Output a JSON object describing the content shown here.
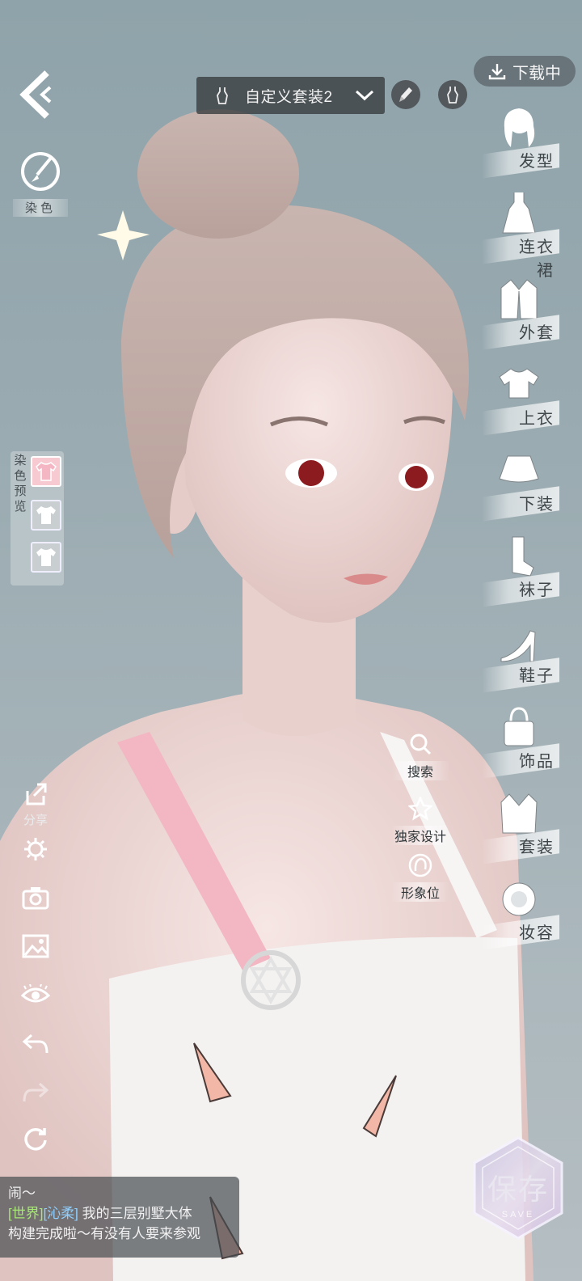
{
  "top_bar": {
    "outfit_name": "自定义套装2",
    "download_label": "下载中"
  },
  "left_panel": {
    "dye_label": "染色",
    "dye_preview_title": [
      "染",
      "色",
      "预",
      "览"
    ],
    "share_label": "分享"
  },
  "categories": [
    {
      "label": "发型",
      "icon": "hair-icon"
    },
    {
      "label": "连衣裙",
      "icon": "dress-icon"
    },
    {
      "label": "外套",
      "icon": "coat-icon"
    },
    {
      "label": "上衣",
      "icon": "top-icon"
    },
    {
      "label": "下装",
      "icon": "skirt-icon"
    },
    {
      "label": "袜子",
      "icon": "socks-icon"
    },
    {
      "label": "鞋子",
      "icon": "heels-icon"
    },
    {
      "label": "饰品",
      "icon": "handbag-icon"
    },
    {
      "label": "套装",
      "icon": "suit-icon"
    },
    {
      "label": "妆容",
      "icon": "makeup-icon"
    }
  ],
  "center_actions": {
    "search": "搜索",
    "exclusive_design": "独家设计",
    "image_slot": "形象位"
  },
  "chat": {
    "line1": "闹～",
    "channel": "[世界]",
    "sender": "[沁柔]",
    "message_part1": "我的三层别墅大体",
    "message_part2": "构建完成啦～有没有人要来参观"
  },
  "save": {
    "label": "保存",
    "sub_label": "SAVE"
  },
  "colors": {
    "background": "#9aabb1",
    "swatch_pink": "#f4b6c2",
    "chat_channel": "#a6e874",
    "chat_sender": "#8fd0ff"
  }
}
